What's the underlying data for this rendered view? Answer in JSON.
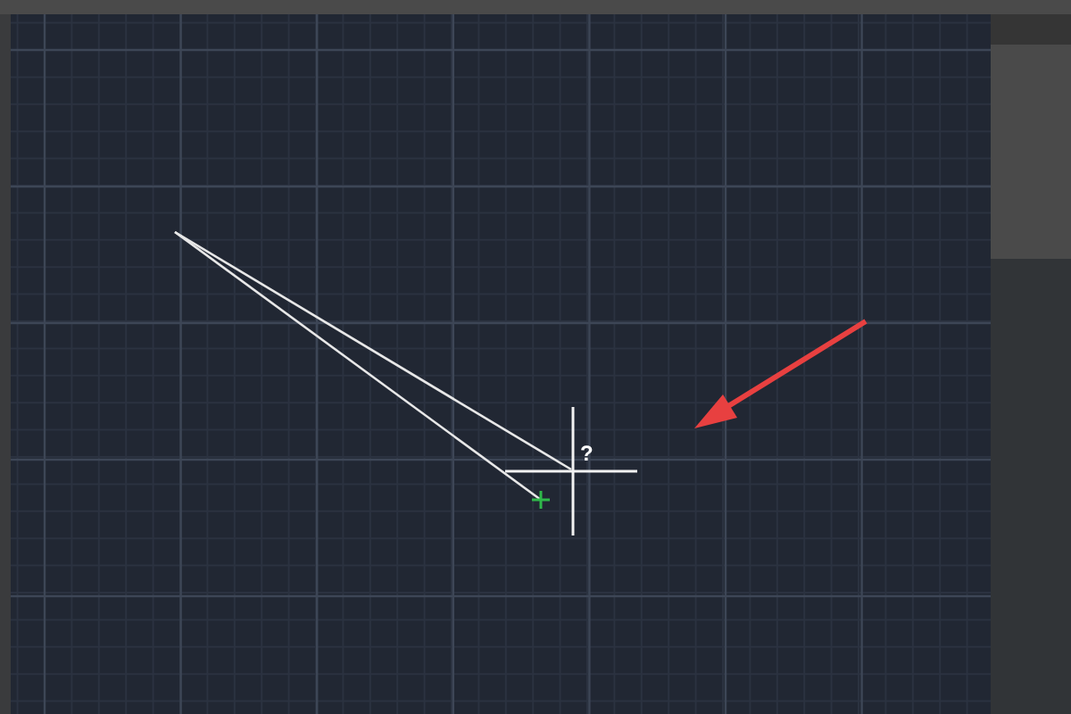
{
  "canvas": {
    "cursor": {
      "tooltip": "?"
    }
  }
}
